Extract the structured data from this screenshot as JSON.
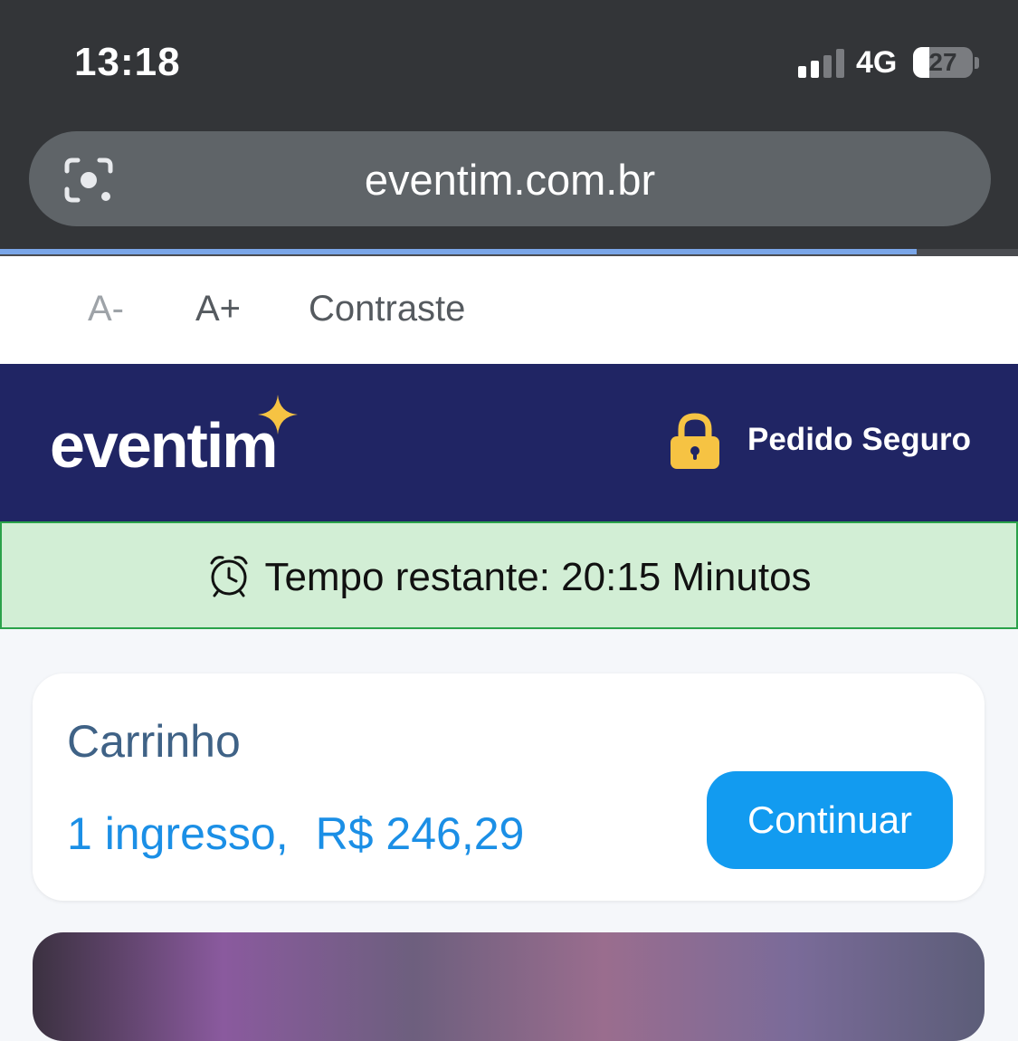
{
  "status_bar": {
    "time": "13:18",
    "network": "4G",
    "battery_level": "27",
    "signal_bars": 2
  },
  "browser": {
    "url": "eventim.com.br",
    "icon": "lens-icon",
    "load_progress": 0.9
  },
  "accessibility": {
    "decrease": "A-",
    "increase": "A+",
    "contrast": "Contraste"
  },
  "header": {
    "logo_text": "eventim",
    "secure_label": "Pedido Seguro",
    "brand_color": "#202564",
    "accent_color": "#f6c343"
  },
  "timer": {
    "label": "Tempo restante: 20:15 Minutos",
    "icon": "alarm-clock-icon"
  },
  "cart": {
    "title": "Carrinho",
    "tickets": "1 ingresso,",
    "price": "R$ 246,29",
    "continue_label": "Continuar"
  }
}
